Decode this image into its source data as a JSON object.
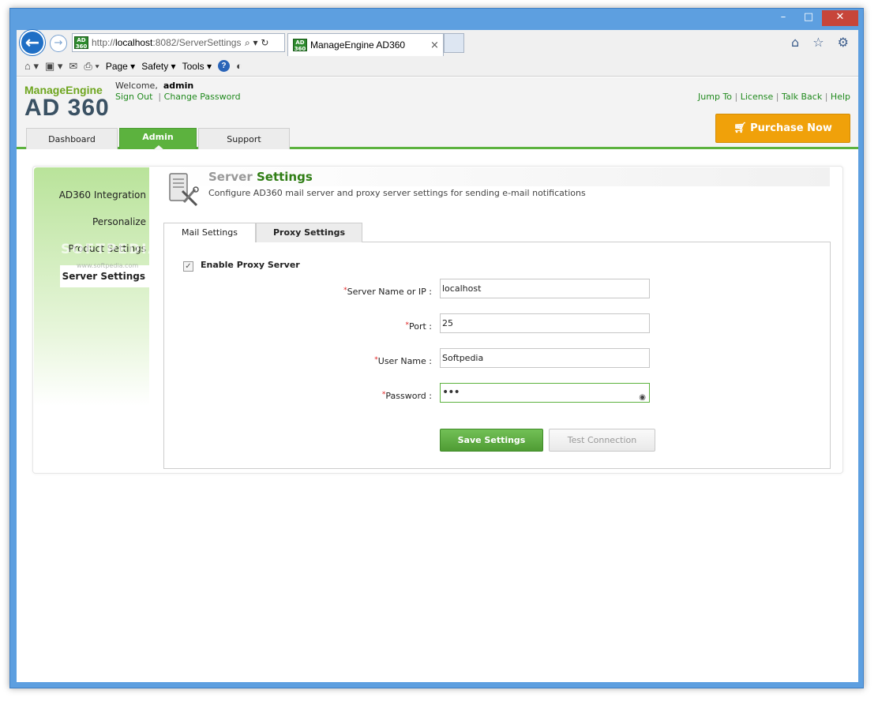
{
  "window": {
    "minimize": "–",
    "maximize": "□",
    "close": "✕"
  },
  "browser": {
    "url_prefix": "http://",
    "url_host": "localhost",
    "url_rest": ":8082/ServerSettings",
    "url_tools": "⌕ ▾ ↻",
    "tab_title": "ManageEngine AD360",
    "tab_close": "×",
    "site_icon_text": "AD 360",
    "fav_icons": "⌂ ☆ ⚙",
    "commands": [
      "Page ▾",
      "Safety ▾",
      "Tools ▾"
    ]
  },
  "header": {
    "logo_top": "ManageEngine",
    "logo_main": "AD 360",
    "welcome_prefix": "Welcome,",
    "username": "admin",
    "sign_out": "Sign Out",
    "change_password": "Change Password",
    "top_links": [
      "Jump To",
      "License",
      "Talk Back",
      "Help"
    ],
    "purchase": "Purchase Now"
  },
  "nav": {
    "tabs": [
      "Dashboard",
      "Admin",
      "Support"
    ],
    "active": "Admin"
  },
  "sidebar": {
    "items": [
      "AD360 Integration",
      "Personalize",
      "Product Settings",
      "Server Settings"
    ],
    "active": "Server Settings",
    "watermark": "SOFTPEDIA",
    "watermark_url": "www.softpedia.com"
  },
  "settings": {
    "title_grey": "Server",
    "title_green": "Settings",
    "description": "Configure AD360 mail server and proxy server settings for sending e-mail notifications",
    "tabs": [
      "Mail Settings",
      "Proxy Settings"
    ],
    "active_tab": "Proxy Settings"
  },
  "form": {
    "enable_proxy_label": "Enable Proxy Server",
    "enable_proxy_checked": true,
    "required_mark": "*",
    "fields": [
      {
        "label": "Server Name or IP :",
        "value": "localhost"
      },
      {
        "label": "Port :",
        "value": "25"
      },
      {
        "label": "User Name :",
        "value": "Softpedia"
      },
      {
        "label": "Password :",
        "value": "•••"
      }
    ],
    "save_button": "Save Settings",
    "test_button": "Test Connection"
  },
  "colors": {
    "accent_green": "#5cb23e",
    "purchase_orange": "#f0a10a",
    "link_green": "#218a1e"
  }
}
